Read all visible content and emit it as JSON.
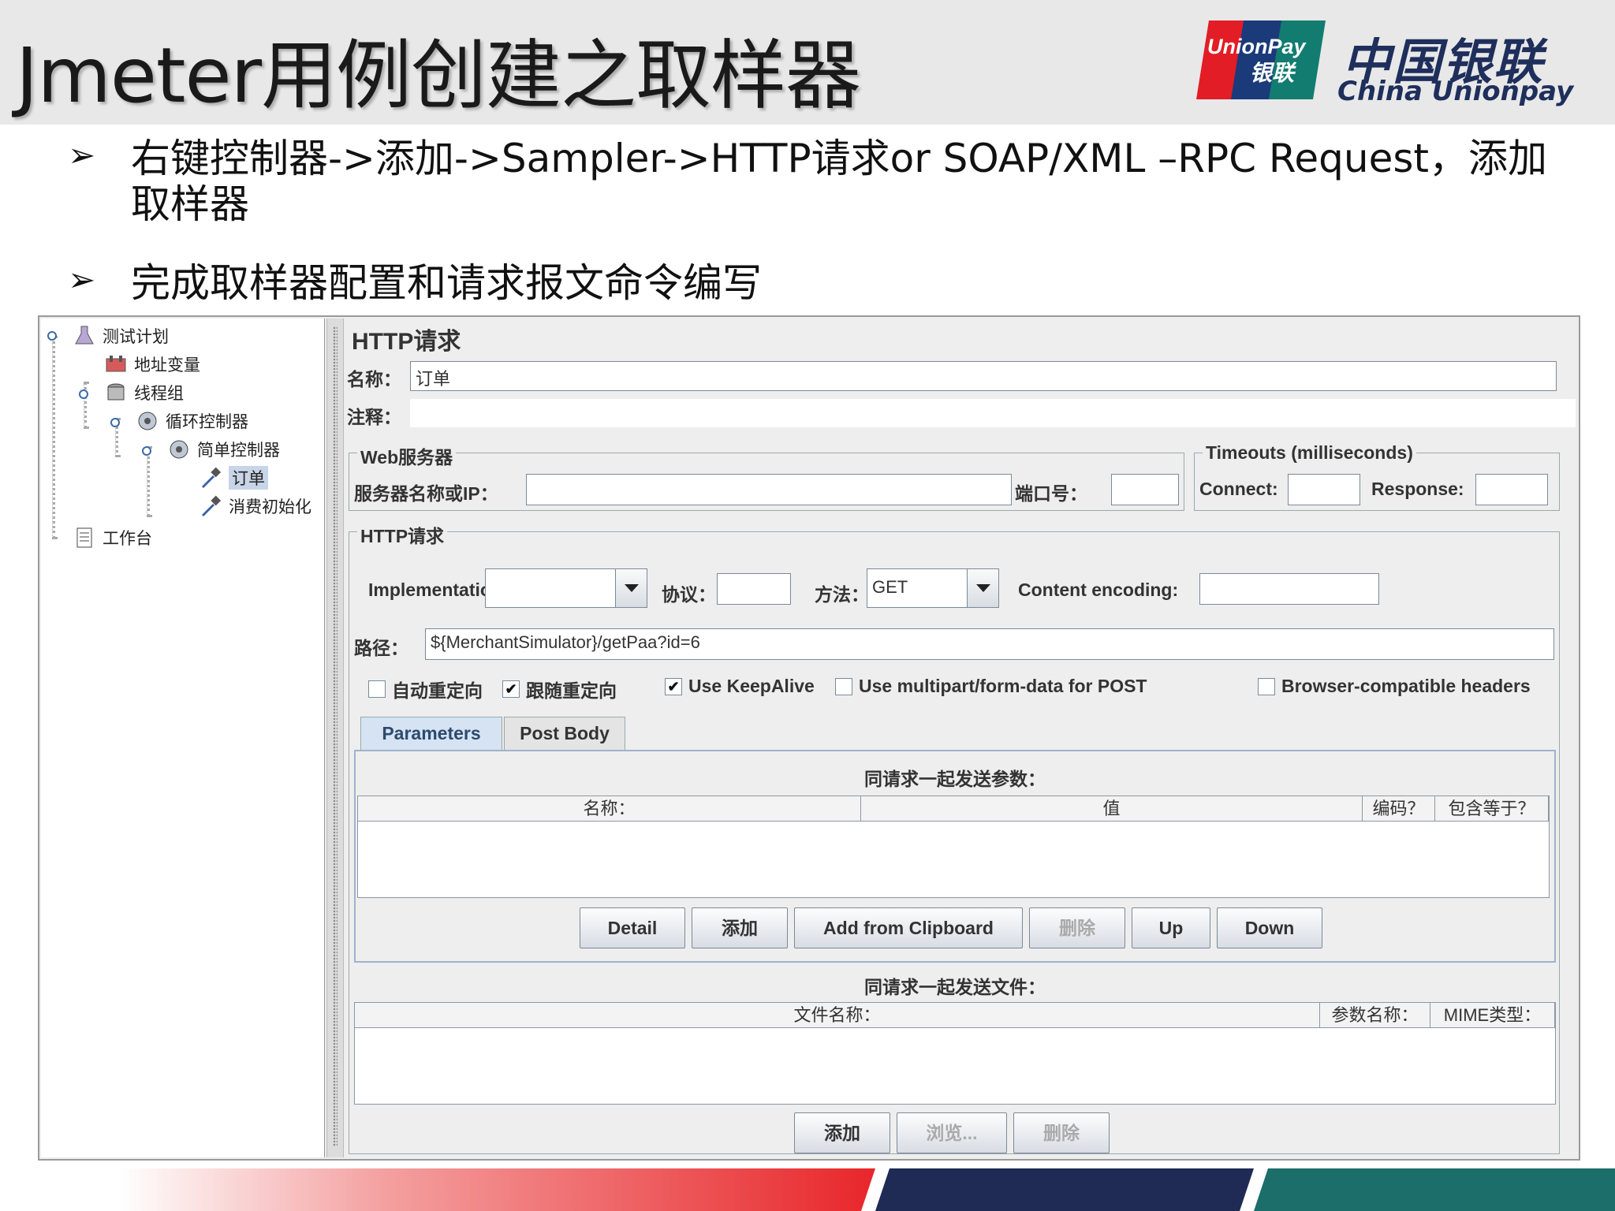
{
  "slide": {
    "title": "Jmeter用例创建之取样器",
    "brand_cn": "中国银联",
    "brand_en": "China Unionpay",
    "logo_text_1": "UnionPay",
    "logo_text_2": "银联",
    "bullets": [
      {
        "line1": "右键控制器->添加->Sampler->HTTP请求or SOAP/XML –RPC Request，添加",
        "line2": "取样器"
      },
      {
        "line1": "完成取样器配置和请求报文命令编写"
      }
    ]
  },
  "tree": {
    "items": [
      {
        "label": "测试计划",
        "icon": "flask-icon"
      },
      {
        "label": "地址变量",
        "icon": "config-element-icon"
      },
      {
        "label": "线程组",
        "icon": "thread-group-icon"
      },
      {
        "label": "循环控制器",
        "icon": "loop-controller-icon"
      },
      {
        "label": "简单控制器",
        "icon": "simple-controller-icon"
      },
      {
        "label": "订单",
        "icon": "sampler-pipette-icon"
      },
      {
        "label": "消费初始化",
        "icon": "sampler-pipette-icon"
      },
      {
        "label": "工作台",
        "icon": "workbench-icon"
      }
    ]
  },
  "http": {
    "panel_title": "HTTP请求",
    "name_label": "名称：",
    "name_value": "订单",
    "comment_label": "注释：",
    "comment_value": "",
    "web_server_title": "Web服务器",
    "server_label": "服务器名称或IP：",
    "server_value": "",
    "port_label": "端口号：",
    "port_value": "",
    "timeouts_title": "Timeouts (milliseconds)",
    "connect_label": "Connect:",
    "connect_value": "",
    "response_label": "Response:",
    "response_value": "",
    "request_title": "HTTP请求",
    "implementation_label": "Implementation:",
    "implementation_value": "",
    "protocol_label": "协议：",
    "protocol_value": "",
    "method_label": "方法：",
    "method_value": "GET",
    "encoding_label": "Content encoding:",
    "encoding_value": "",
    "path_label": "路径：",
    "path_value": "${MerchantSimulator}/getPaa?id=6",
    "checkboxes": [
      {
        "label": "自动重定向",
        "checked": false,
        "mark": ""
      },
      {
        "label": "跟随重定向",
        "checked": true,
        "mark": "✔"
      },
      {
        "label": "Use KeepAlive",
        "checked": true,
        "mark": "✔"
      },
      {
        "label": "Use multipart/form-data for POST",
        "checked": false,
        "mark": ""
      },
      {
        "label": "Browser-compatible headers",
        "checked": false,
        "mark": ""
      }
    ],
    "tabs": [
      {
        "label": "Parameters",
        "active": true
      },
      {
        "label": "Post Body",
        "active": false
      }
    ],
    "params_caption": "同请求一起发送参数：",
    "params_columns": [
      "名称：",
      "值",
      "编码？",
      "包含等于？"
    ],
    "params_buttons": [
      {
        "label": "Detail",
        "enabled": true
      },
      {
        "label": "添加",
        "enabled": true
      },
      {
        "label": "Add from Clipboard",
        "enabled": true
      },
      {
        "label": "删除",
        "enabled": false
      },
      {
        "label": "Up",
        "enabled": true
      },
      {
        "label": "Down",
        "enabled": true
      }
    ],
    "files_caption": "同请求一起发送文件：",
    "files_columns": [
      "文件名称：",
      "参数名称：",
      "MIME类型："
    ],
    "files_buttons": [
      {
        "label": "添加",
        "enabled": true
      },
      {
        "label": "浏览...",
        "enabled": false
      },
      {
        "label": "删除",
        "enabled": false
      }
    ]
  },
  "colors": {
    "brand_navy": "#1f2f5c",
    "footer_red": "#e8262a",
    "footer_navy": "#1f2a55",
    "footer_teal": "#1b6e6a"
  }
}
